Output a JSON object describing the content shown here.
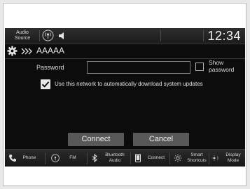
{
  "status_bar": {
    "audio_source_line1": "Audio",
    "audio_source_line2": "Source",
    "clock": "12:34"
  },
  "title_bar": {
    "icon": "gear-icon",
    "separator_icon": "double-chevron-icon",
    "network_name": "AAAAA"
  },
  "form": {
    "password_label": "Password",
    "password_value": "",
    "show_password_line1": "Show",
    "show_password_line2": "password",
    "show_password_checked": false,
    "auto_download_label": "Use this network to automatically download system updates",
    "auto_download_checked": true
  },
  "actions": {
    "connect_label": "Connect",
    "cancel_label": "Cancel"
  },
  "nav": {
    "phone": "Phone",
    "fm": "FM",
    "bluetooth_line1": "Bluetooth",
    "bluetooth_line2": "Audio",
    "connect": "Connect",
    "smart_line1": "Smart",
    "smart_line2": "Shortcuts",
    "display_line1": "Display",
    "display_line2": "Mode"
  },
  "colors": {
    "screen_bg": "#0c0c0c",
    "button_bg": "#585858",
    "text": "#e0e0e0"
  }
}
